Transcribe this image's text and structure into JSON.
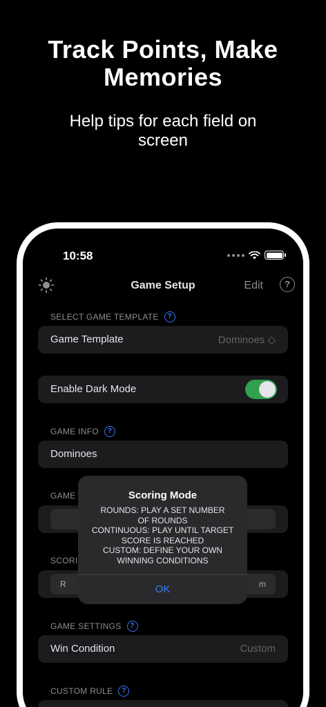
{
  "promo": {
    "headline_line1": "Track Points, Make",
    "headline_line2": "Memories",
    "subline_line1": "Help tips for each field on",
    "subline_line2": "screen"
  },
  "status_bar": {
    "time": "10:58"
  },
  "navbar": {
    "title": "Game Setup",
    "edit_label": "Edit",
    "help_glyph": "?",
    "left_icon": "sun-icon"
  },
  "sections": {
    "template": {
      "header": "SELECT GAME TEMPLATE",
      "row_label": "Game Template",
      "row_value": "Dominoes ◇"
    },
    "dark_mode": {
      "row_label": "Enable Dark Mode",
      "enabled": true
    },
    "game_info": {
      "header": "GAME INFO",
      "row_value": "Dominoes"
    },
    "game_mode": {
      "header_fragment": "GAME M"
    },
    "scoring": {
      "header_fragment": "SCORIN",
      "segment_left_fragment": "R",
      "segment_right_fragment": "m"
    },
    "game_settings": {
      "header": "GAME SETTINGS",
      "row_label": "Win Condition",
      "row_value": "Custom"
    },
    "custom_rule": {
      "header": "CUSTOM RULE"
    }
  },
  "alert": {
    "title": "Scoring Mode",
    "lines": [
      "ROUNDS: PLAY A SET NUMBER",
      "OF ROUNDS",
      "CONTINUOUS: PLAY UNTIL TARGET",
      "SCORE IS REACHED",
      "CUSTOM: DEFINE YOUR OWN",
      "WINNING CONDITIONS"
    ],
    "ok_label": "OK"
  },
  "colors": {
    "accent": "#3478f6",
    "toggle_on": "#30a14e",
    "background": "#000000",
    "row_bg": "#1c1c1e"
  }
}
